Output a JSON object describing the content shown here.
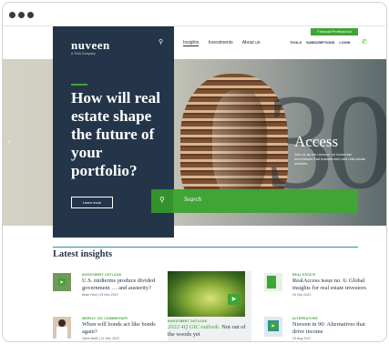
{
  "header": {
    "logo": "nuveen",
    "logo_sub": "A TIAA Company",
    "nav": [
      "Insights",
      "Investments",
      "About us"
    ],
    "utility": [
      "TOOLS",
      "SUBSCRIPTIONS",
      "LOGIN"
    ],
    "pro_badge": "Financial Professional"
  },
  "hero": {
    "headline": "How will real estate shape the future of your portfolio?",
    "cta": "Learn more",
    "access_title": "Access",
    "access_sub": "Join us as we uncover on tomorrow innovations that transformed and real estate markets."
  },
  "search": {
    "placeholder": "Search"
  },
  "insights": {
    "title": "Latest insights",
    "cards": [
      {
        "category": "INVESTMENT OUTLOOK",
        "title": "U.S. midterms produce divided government … and austerity?",
        "meta": "Brian Nick | 09 Nov 2022"
      },
      {
        "category": "WEEKLY CIO COMMENTARY",
        "title": "When will bonds act like bonds again?",
        "meta": "Saira Malik | 21 Nov 2022"
      },
      {
        "category": "INVESTMENT OUTLOOK",
        "title_highlight": "2022 4Q GIC outlook:",
        "title_rest": " Not out of the woods yet"
      },
      {
        "category": "REAL ESTATE",
        "title": "RealAccess issue no. 6: Global insights for real estate investors",
        "meta": "26 Sep 2022"
      },
      {
        "category": "ALTERNATIVES",
        "title": "Nuveen in 90: Alternatives that drive income",
        "meta": "26 Aug 2022"
      }
    ]
  }
}
